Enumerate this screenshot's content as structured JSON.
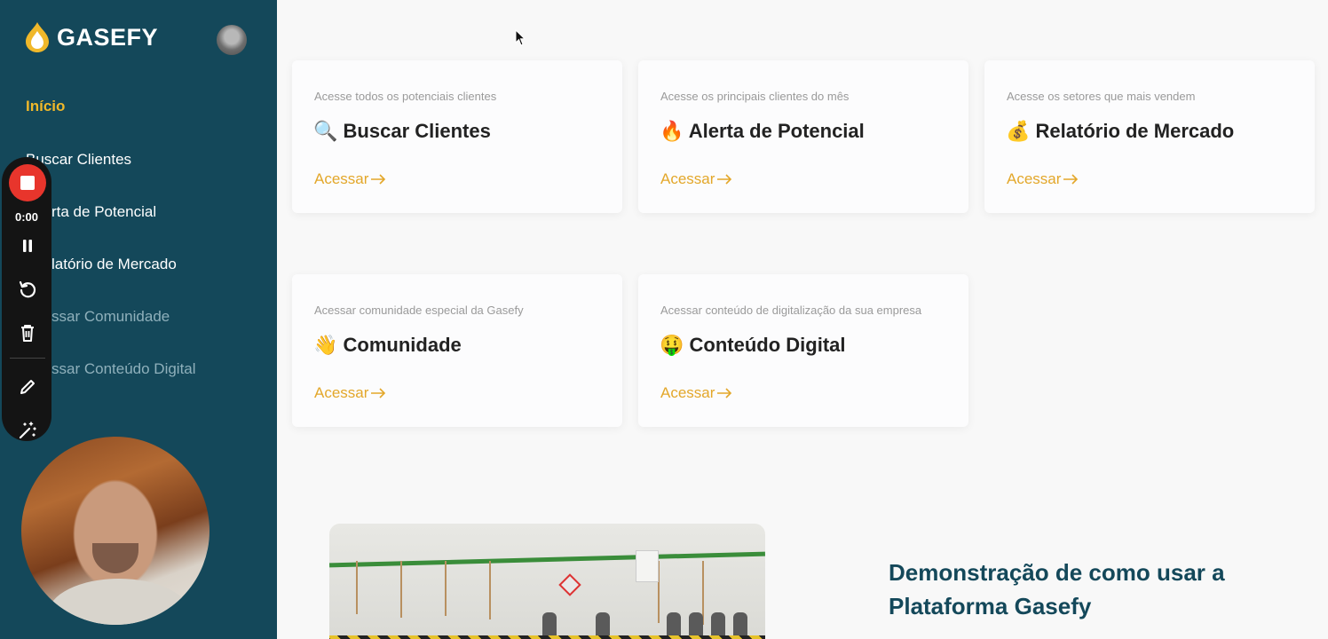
{
  "brand": {
    "name": "GASEFY",
    "accent": "#f0b82a",
    "sidebar_bg": "#14485a"
  },
  "sidebar": {
    "items": [
      {
        "label": "Início"
      },
      {
        "label": "Buscar Clientes"
      },
      {
        "label": "rta de Potencial"
      },
      {
        "label": "latório de Mercado"
      },
      {
        "label": "ssar Comunidade"
      },
      {
        "label": "ssar Conteúdo Digital"
      }
    ]
  },
  "recorder": {
    "time": "0:00"
  },
  "cards": [
    {
      "subtitle": "Acesse todos os potenciais clientes",
      "emoji": "🔍",
      "title": "Buscar Clientes",
      "link": "Acessar"
    },
    {
      "subtitle": "Acesse os principais clientes do mês",
      "emoji": "🔥",
      "title": "Alerta de Potencial",
      "link": "Acessar"
    },
    {
      "subtitle": "Acesse os setores que mais vendem",
      "emoji": "💰",
      "title": "Relatório de Mercado",
      "link": "Acessar"
    },
    {
      "subtitle": "Acessar comunidade especial da Gasefy",
      "emoji": "👋",
      "title": "Comunidade",
      "link": "Acessar"
    },
    {
      "subtitle": "Acessar conteúdo de digitalização da sua empresa",
      "emoji": "🤑",
      "title": "Conteúdo Digital",
      "link": "Acessar"
    }
  ],
  "demo": {
    "title": "Demonstração de como usar a Plataforma Gasefy"
  }
}
